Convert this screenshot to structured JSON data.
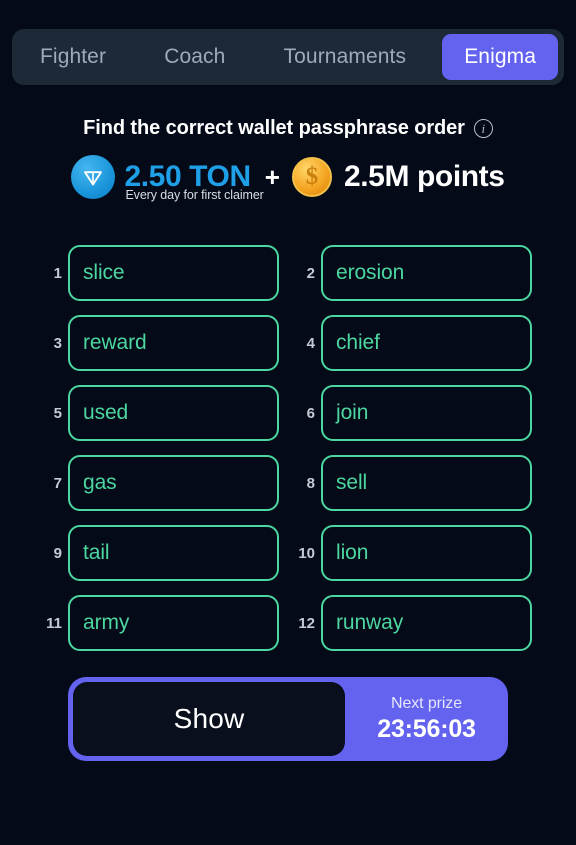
{
  "theme": {
    "background": "#040a17",
    "tabbar_bg": "#1e2938",
    "accent_purple": "#6363f0",
    "accent_green": "#4cd6a0",
    "ton_blue": "#1e9fe8",
    "coin_gold": "#f5a623"
  },
  "tabs": [
    {
      "label": "Fighter",
      "active": false
    },
    {
      "label": "Coach",
      "active": false
    },
    {
      "label": "Tournaments",
      "active": false
    },
    {
      "label": "Enigma",
      "active": true
    }
  ],
  "heading": {
    "text": "Find the correct wallet passphrase order",
    "info_icon": "info-circle-icon"
  },
  "prize": {
    "ton_icon": "ton-coin-icon",
    "ton_amount": "2.50 TON",
    "ton_subtitle": "Every day for first claimer",
    "separator": "+",
    "coin_icon": "dollar-coin-icon",
    "points_amount": "2.5M points"
  },
  "words": [
    {
      "num": "1",
      "word": "slice"
    },
    {
      "num": "2",
      "word": "erosion"
    },
    {
      "num": "3",
      "word": "reward"
    },
    {
      "num": "4",
      "word": "chief"
    },
    {
      "num": "5",
      "word": "used"
    },
    {
      "num": "6",
      "word": "join"
    },
    {
      "num": "7",
      "word": "gas"
    },
    {
      "num": "8",
      "word": "sell"
    },
    {
      "num": "9",
      "word": "tail"
    },
    {
      "num": "10",
      "word": "lion"
    },
    {
      "num": "11",
      "word": "army"
    },
    {
      "num": "12",
      "word": "runway"
    }
  ],
  "actions": {
    "show_label": "Show",
    "next_prize_label": "Next prize",
    "next_prize_timer": "23:56:03"
  }
}
